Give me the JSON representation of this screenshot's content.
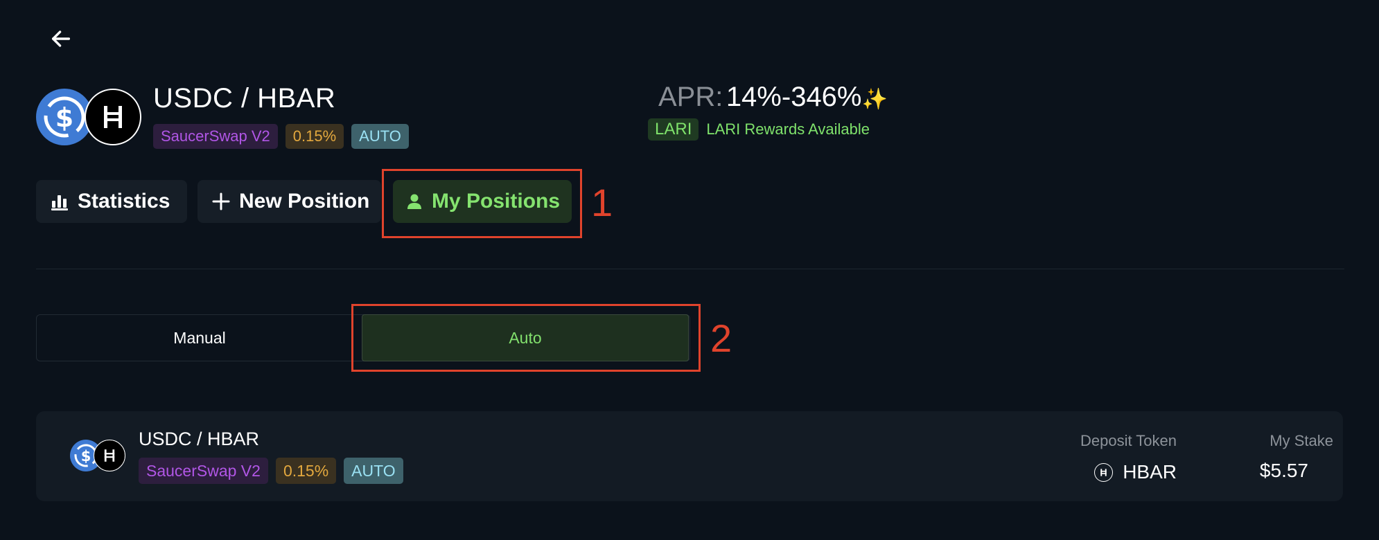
{
  "header": {
    "back_icon": "arrow-left-icon",
    "pair_title": "USDC / HBAR",
    "tags": {
      "dex": "SaucerSwap V2",
      "fee": "0.15%",
      "mode": "AUTO"
    },
    "token_icons": [
      "usdc-icon",
      "hbar-icon"
    ],
    "apr": {
      "label": "APR:",
      "value": "14%-346%",
      "sparkle": "✨"
    },
    "rewards": {
      "badge": "LARI",
      "text": "LARI Rewards Available"
    }
  },
  "nav": {
    "statistics": "Statistics",
    "new_position": "New Position",
    "my_positions": "My Positions",
    "active": "my_positions"
  },
  "mode_toggle": {
    "manual": "Manual",
    "auto": "Auto",
    "selected": "auto"
  },
  "annotations": {
    "first": "1",
    "second": "2"
  },
  "positions": [
    {
      "pair": "USDC / HBAR",
      "dex": "SaucerSwap V2",
      "fee": "0.15%",
      "mode": "AUTO",
      "deposit_token_label": "Deposit Token",
      "deposit_token": "HBAR",
      "stake_label": "My Stake",
      "stake": "$5.57"
    }
  ],
  "colors": {
    "background": "#0b121b",
    "accent_green": "#85e36f",
    "annotation_red": "#e0432c",
    "dex_purple": "#b156e6",
    "fee_orange": "#e3a83e",
    "auto_cyan": "#9ae1f3",
    "usdc_blue": "#3f7bd4"
  }
}
